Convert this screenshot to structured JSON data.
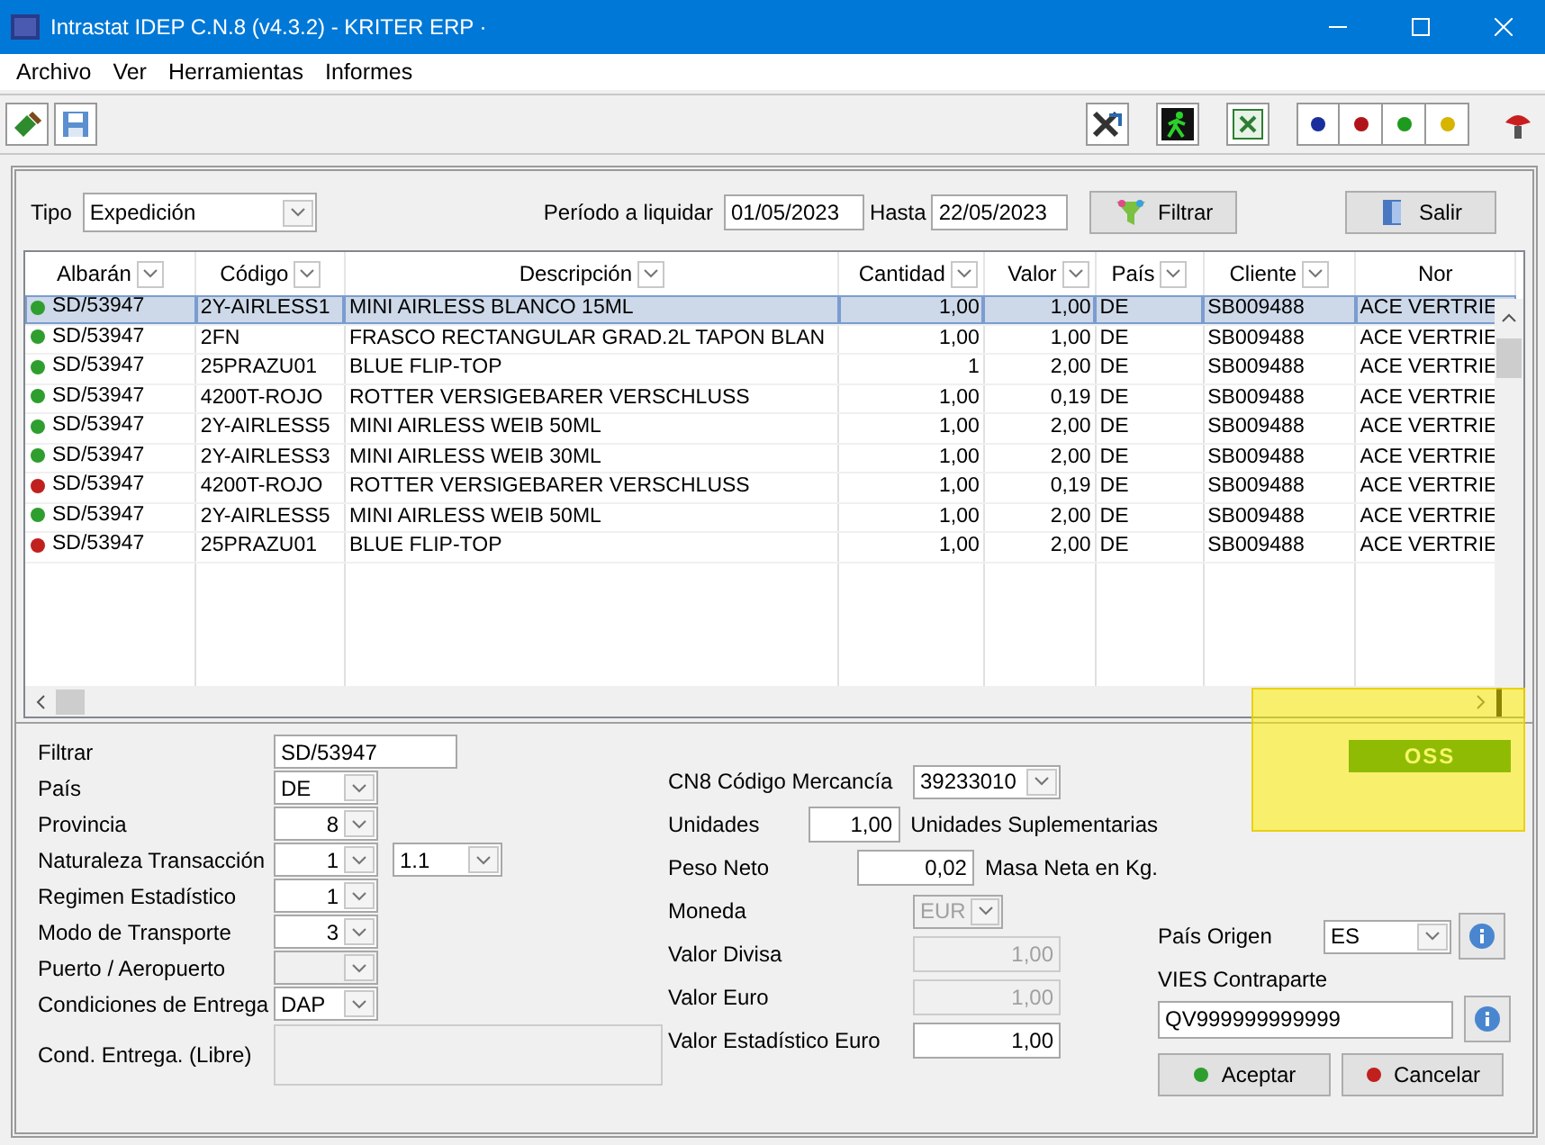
{
  "window": {
    "title": "Intrastat IDEP C.N.8 (v4.3.2) - KRITER ERP ·"
  },
  "menu": [
    "Archivo",
    "Ver",
    "Herramientas",
    "Informes"
  ],
  "toolbar": {
    "color_buttons": [
      {
        "color": "#1a2f9c"
      },
      {
        "color": "#b0141a"
      },
      {
        "color": "#1e9a1e"
      },
      {
        "color": "#d6b400"
      }
    ]
  },
  "filter_bar": {
    "tipo_label": "Tipo",
    "tipo_value": "Expedición",
    "period_label": "Período a liquidar",
    "from": "01/05/2023",
    "until_label": "Hasta",
    "until": "22/05/2023",
    "filter_button": "Filtrar",
    "exit_button": "Salir"
  },
  "table": {
    "columns": [
      {
        "label": "Albarán",
        "filter": true,
        "kind": "text"
      },
      {
        "label": "Código",
        "filter": true,
        "kind": "text"
      },
      {
        "label": "Descripción",
        "filter": true,
        "kind": "text"
      },
      {
        "label": "Cantidad",
        "filter": true,
        "kind": "number"
      },
      {
        "label": "Valor",
        "filter": true,
        "kind": "number"
      },
      {
        "label": "País",
        "filter": true,
        "kind": "text"
      },
      {
        "label": "Cliente",
        "filter": true,
        "kind": "text"
      },
      {
        "label": "Nor",
        "filter": false,
        "kind": "text"
      }
    ],
    "rows": [
      {
        "color": "#2e9e2e",
        "selected": true,
        "cells": [
          "SD/53947",
          "2Y-AIRLESS1",
          "MINI AIRLESS BLANCO 15ML",
          "1,00",
          "1,00",
          "DE",
          "SB009488",
          "ACE VERTRIE"
        ]
      },
      {
        "color": "#2e9e2e",
        "selected": false,
        "cells": [
          "SD/53947",
          "2FN",
          "FRASCO RECTANGULAR GRAD.2L TAPON BLAN",
          "1,00",
          "1,00",
          "DE",
          "SB009488",
          "ACE VERTRIE"
        ]
      },
      {
        "color": "#2e9e2e",
        "selected": false,
        "cells": [
          "SD/53947",
          "25PRAZU01",
          "BLUE FLIP-TOP",
          "1",
          "2,00",
          "DE",
          "SB009488",
          "ACE VERTRIE"
        ]
      },
      {
        "color": "#2e9e2e",
        "selected": false,
        "cells": [
          "SD/53947",
          "4200T-ROJO",
          "ROTTER VERSIGEBARER VERSCHLUSS",
          "1,00",
          "0,19",
          "DE",
          "SB009488",
          "ACE VERTRIE"
        ]
      },
      {
        "color": "#2e9e2e",
        "selected": false,
        "cells": [
          "SD/53947",
          "2Y-AIRLESS5",
          "MINI AIRLESS WEIB 50ML",
          "1,00",
          "2,00",
          "DE",
          "SB009488",
          "ACE VERTRIE"
        ]
      },
      {
        "color": "#2e9e2e",
        "selected": false,
        "cells": [
          "SD/53947",
          "2Y-AIRLESS3",
          "MINI AIRLESS WEIB 30ML",
          "1,00",
          "2,00",
          "DE",
          "SB009488",
          "ACE VERTRIE"
        ]
      },
      {
        "color": "#c0201e",
        "selected": false,
        "cells": [
          "SD/53947",
          "4200T-ROJO",
          "ROTTER VERSIGEBARER VERSCHLUSS",
          "1,00",
          "0,19",
          "DE",
          "SB009488",
          "ACE VERTRIE"
        ]
      },
      {
        "color": "#2e9e2e",
        "selected": false,
        "cells": [
          "SD/53947",
          "2Y-AIRLESS5",
          "MINI AIRLESS WEIB 50ML",
          "1,00",
          "2,00",
          "DE",
          "SB009488",
          "ACE VERTRIE"
        ]
      },
      {
        "color": "#c0201e",
        "selected": false,
        "cells": [
          "SD/53947",
          "25PRAZU01",
          "BLUE FLIP-TOP",
          "1,00",
          "2,00",
          "DE",
          "SB009488",
          "ACE VERTRIE"
        ]
      }
    ]
  },
  "form_left": [
    {
      "label": "Filtrar",
      "kind": "text",
      "value": "SD/53947",
      "disabled": false
    },
    {
      "label": "País",
      "kind": "combo",
      "value": "DE",
      "disabled": false
    },
    {
      "label": "Provincia",
      "kind": "number_combo",
      "value": "8",
      "disabled": false
    },
    {
      "label": "Naturaleza Transacción",
      "kind": "number_combo",
      "value": "1",
      "disabled": false,
      "extra": "1.1"
    },
    {
      "label": "Regimen Estadístico",
      "kind": "number_combo",
      "value": "1",
      "disabled": false
    },
    {
      "label": "Modo de Transporte",
      "kind": "number_combo",
      "value": "3",
      "disabled": false
    },
    {
      "label": "Puerto / Aeropuerto",
      "kind": "number_combo",
      "disabled": true
    },
    {
      "label": "Condiciones de Entrega",
      "kind": "combo",
      "value": "DAP",
      "disabled": false
    },
    {
      "label": "Cond. Entrega. (Libre)",
      "kind": "memo",
      "disabled": true
    }
  ],
  "form_middle": [
    {
      "label": "CN8 Código Mercancía",
      "kind": "combo",
      "value": "39233010",
      "disabled": false
    },
    {
      "label": "Unidades",
      "kind": "number",
      "value": "1,00",
      "disabled": false,
      "note": "Unidades Suplementarias"
    },
    {
      "label": "Peso Neto",
      "kind": "number",
      "value": "0,02",
      "disabled": false,
      "note": "Masa Neta en Kg."
    },
    {
      "label": "Moneda",
      "kind": "combo",
      "value": "EUR",
      "disabled": true
    },
    {
      "label": "Valor Divisa",
      "kind": "number",
      "value": "1,00",
      "disabled": true
    },
    {
      "label": "Valor Euro",
      "kind": "number",
      "value": "1,00",
      "disabled": true
    },
    {
      "label": "Valor Estadístico Euro",
      "kind": "number",
      "value": "1,00",
      "disabled": false
    }
  ],
  "oss_badge": "OSS",
  "origin": {
    "label": "País Origen",
    "value": "ES"
  },
  "vies": {
    "label": "VIES Contraparte",
    "value": "QV999999999999"
  },
  "buttons": [
    {
      "label": "Aceptar",
      "color": "#2e9e2e"
    },
    {
      "label": "Cancelar",
      "color": "#c0201e"
    }
  ]
}
